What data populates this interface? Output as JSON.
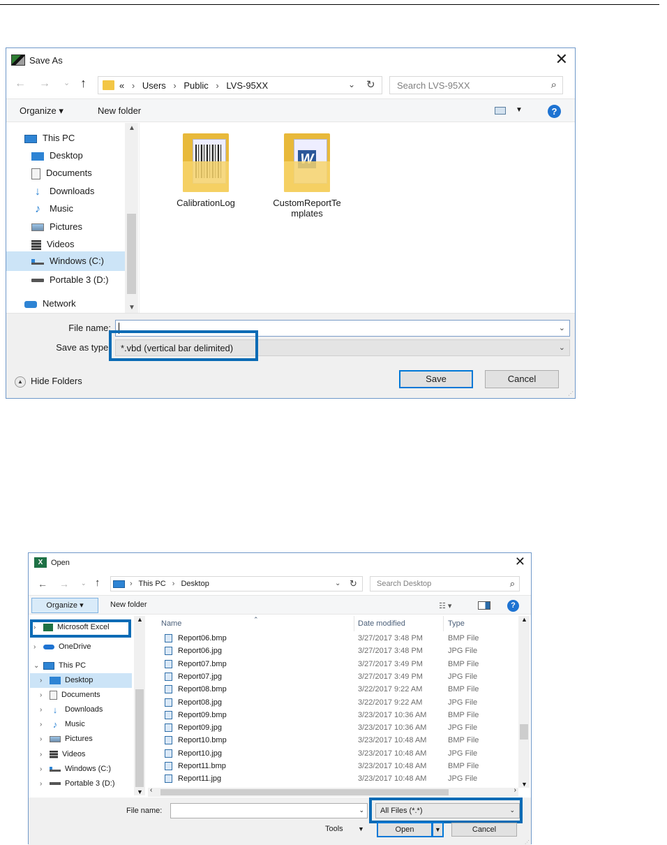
{
  "save_dialog": {
    "title": "Save As",
    "close": "✕",
    "path": [
      "Users",
      "Public",
      "LVS-95XX"
    ],
    "path_prefix": "«",
    "search_placeholder": "Search LVS-95XX",
    "toolbar": {
      "organize": "Organize ▾",
      "new_folder": "New folder",
      "help": "?"
    },
    "nav_items": [
      {
        "label": "This PC",
        "icon": "pc-icon"
      },
      {
        "label": "Desktop",
        "icon": "desktop-icon"
      },
      {
        "label": "Documents",
        "icon": "documents-icon"
      },
      {
        "label": "Downloads",
        "icon": "downloads-icon"
      },
      {
        "label": "Music",
        "icon": "music-icon"
      },
      {
        "label": "Pictures",
        "icon": "pictures-icon"
      },
      {
        "label": "Videos",
        "icon": "videos-icon"
      },
      {
        "label": "Windows (C:)",
        "icon": "drive-icon",
        "selected": true
      },
      {
        "label": "Portable 3 (D:)",
        "icon": "removable-drive-icon"
      },
      {
        "label": "Network",
        "icon": "network-icon"
      }
    ],
    "files": [
      {
        "name": "CalibrationLog",
        "icon": "folder-barcode-icon"
      },
      {
        "name": "CustomReportTe\nmplates",
        "icon": "folder-word-icon"
      }
    ],
    "file_name_label": "File name:",
    "file_name_value": "",
    "save_type_label": "Save as type:",
    "save_type_value": "*.vbd (vertical bar delimited)",
    "hide_folders": "Hide Folders",
    "save_button": "Save",
    "cancel_button": "Cancel"
  },
  "open_dialog": {
    "title": "Open",
    "close": "✕",
    "path": [
      "This PC",
      "Desktop"
    ],
    "search_placeholder": "Search Desktop",
    "toolbar": {
      "organize": "Organize ▾",
      "new_folder": "New folder",
      "help": "?"
    },
    "nav_items": [
      {
        "label": "Microsoft Excel",
        "icon": "excel-icon",
        "chevron": ">"
      },
      {
        "label": "OneDrive",
        "icon": "onedrive-icon",
        "chevron": ">"
      },
      {
        "label": "This PC",
        "icon": "pc-icon",
        "chevron": "v"
      },
      {
        "label": "Desktop",
        "icon": "desktop-icon",
        "chevron": ">",
        "selected": true
      },
      {
        "label": "Documents",
        "icon": "documents-icon",
        "chevron": ">"
      },
      {
        "label": "Downloads",
        "icon": "downloads-icon",
        "chevron": ">"
      },
      {
        "label": "Music",
        "icon": "music-icon",
        "chevron": ">"
      },
      {
        "label": "Pictures",
        "icon": "pictures-icon",
        "chevron": ">"
      },
      {
        "label": "Videos",
        "icon": "videos-icon",
        "chevron": ">"
      },
      {
        "label": "Windows (C:)",
        "icon": "drive-icon",
        "chevron": ">"
      },
      {
        "label": "Portable 3 (D:)",
        "icon": "removable-drive-icon",
        "chevron": ">"
      }
    ],
    "columns": {
      "name": "Name",
      "date": "Date modified",
      "type": "Type"
    },
    "rows": [
      {
        "name": "Report06.bmp",
        "date": "3/27/2017 3:48 PM",
        "type": "BMP File"
      },
      {
        "name": "Report06.jpg",
        "date": "3/27/2017 3:48 PM",
        "type": "JPG File"
      },
      {
        "name": "Report07.bmp",
        "date": "3/27/2017 3:49 PM",
        "type": "BMP File"
      },
      {
        "name": "Report07.jpg",
        "date": "3/27/2017 3:49 PM",
        "type": "JPG File"
      },
      {
        "name": "Report08.bmp",
        "date": "3/22/2017 9:22 AM",
        "type": "BMP File"
      },
      {
        "name": "Report08.jpg",
        "date": "3/22/2017 9:22 AM",
        "type": "JPG File"
      },
      {
        "name": "Report09.bmp",
        "date": "3/23/2017 10:36 AM",
        "type": "BMP File"
      },
      {
        "name": "Report09.jpg",
        "date": "3/23/2017 10:36 AM",
        "type": "JPG File"
      },
      {
        "name": "Report10.bmp",
        "date": "3/23/2017 10:48 AM",
        "type": "BMP File"
      },
      {
        "name": "Report10.jpg",
        "date": "3/23/2017 10:48 AM",
        "type": "JPG File"
      },
      {
        "name": "Report11.bmp",
        "date": "3/23/2017 10:48 AM",
        "type": "BMP File"
      },
      {
        "name": "Report11.jpg",
        "date": "3/23/2017 10:48 AM",
        "type": "JPG File"
      }
    ],
    "file_name_label": "File name:",
    "file_name_value": "",
    "file_type_value": "All Files (*.*)",
    "tools_label": "Tools",
    "open_button": "Open",
    "cancel_button": "Cancel"
  },
  "colors": {
    "accent": "#0078d7",
    "highlight_border": "#0a6bb5",
    "selection": "#cce4f7"
  }
}
